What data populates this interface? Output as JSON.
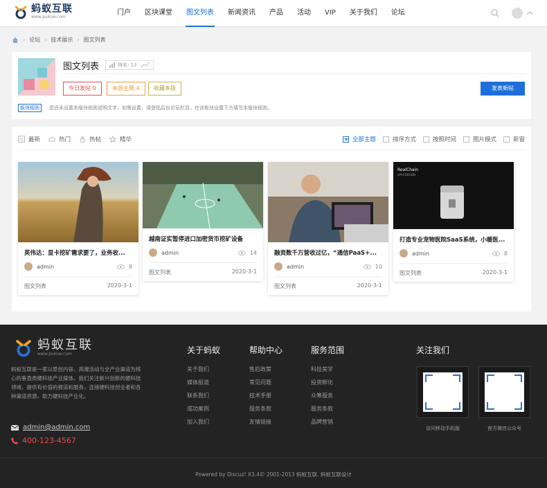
{
  "header": {
    "logo_title": "蚂蚁互联",
    "logo_sub": "www.pukuw.com",
    "nav": [
      "门户",
      "区块课堂",
      "图文列表",
      "新闻资讯",
      "产品",
      "活动",
      "VIP",
      "关于我们",
      "论坛"
    ],
    "active_nav": 2
  },
  "breadcrumb": [
    "论坛",
    "技术展示",
    "图文列表"
  ],
  "forum": {
    "title": "图文列表",
    "rank": "排名: 13",
    "stats": [
      "今日发帖 0",
      "本版主题 4",
      "收藏本版"
    ],
    "post_button": "发表新帖",
    "rule_tag": "板块规则",
    "rule_text": "您还未设置本版块规则说明文字，如需设置，请登陆后台论坛栏目，在该板块设置下方填写本版块规则。"
  },
  "filters": {
    "left": [
      "最新",
      "热门",
      "热帖",
      "精华"
    ],
    "right": [
      "全部主题",
      "排序方式",
      "按照时间",
      "图片模式",
      "新窗"
    ]
  },
  "cards": [
    {
      "title": "英伟达：显卡挖矿需求要了，业务收...",
      "author": "admin",
      "views": "8",
      "forum": "图文列表",
      "date": "2020-3-1"
    },
    {
      "title": "越南证实暂停进口加密货币挖矿设备",
      "author": "admin",
      "views": "14",
      "forum": "图文列表",
      "date": "2020-3-1"
    },
    {
      "title": "融资数千万营收过亿，“通信PaaS+...",
      "author": "admin",
      "views": "10",
      "forum": "图文列表",
      "date": "2020-3-1"
    },
    {
      "title": "打造专业宠物医院SaaS系统，小暖医...",
      "author": "admin",
      "views": "8",
      "forum": "图文列表",
      "date": "2020-3-1"
    }
  ],
  "card4_img_text": [
    "RealChain",
    "$PVCDESIGN"
  ],
  "footer": {
    "logo_title": "蚂蚁互联",
    "logo_sub": "www.pukuw.com",
    "desc": "蚂蚁互联是一家以原创内容、高端活动与全产业渠道为核心的垂直类硬科技产业媒体。我们关注新兴创新的硬科技领域，提供有价值的报道和服务，连接硬科技创业者和各种渠道资源，助力硬科技产业化。",
    "email": "admin@admin.com",
    "phone": "400-123-4567",
    "cols": [
      {
        "title": "关于蚂蚁",
        "items": [
          "关于我们",
          "媒体报道",
          "联系我们",
          "成功案例",
          "加入我们"
        ]
      },
      {
        "title": "帮助中心",
        "items": [
          "售后政策",
          "常见问题",
          "技术手册",
          "服务条款",
          "友情链接"
        ]
      },
      {
        "title": "服务范围",
        "items": [
          "科技美学",
          "投资孵化",
          "众筹服务",
          "服务条款",
          "品牌营销"
        ]
      }
    ],
    "follow_title": "关注我们",
    "qr_captions": [
      "访问移动手机版",
      "官方微信公众号"
    ],
    "copyright": "Powered by Discuz! X3.4© 2001-2013 蚂蚁互联. 蚂蚁互联设计"
  },
  "colors": {
    "accent": "#1e6fd9",
    "footer_bg": "#232323",
    "phone": "#e94b4b"
  }
}
